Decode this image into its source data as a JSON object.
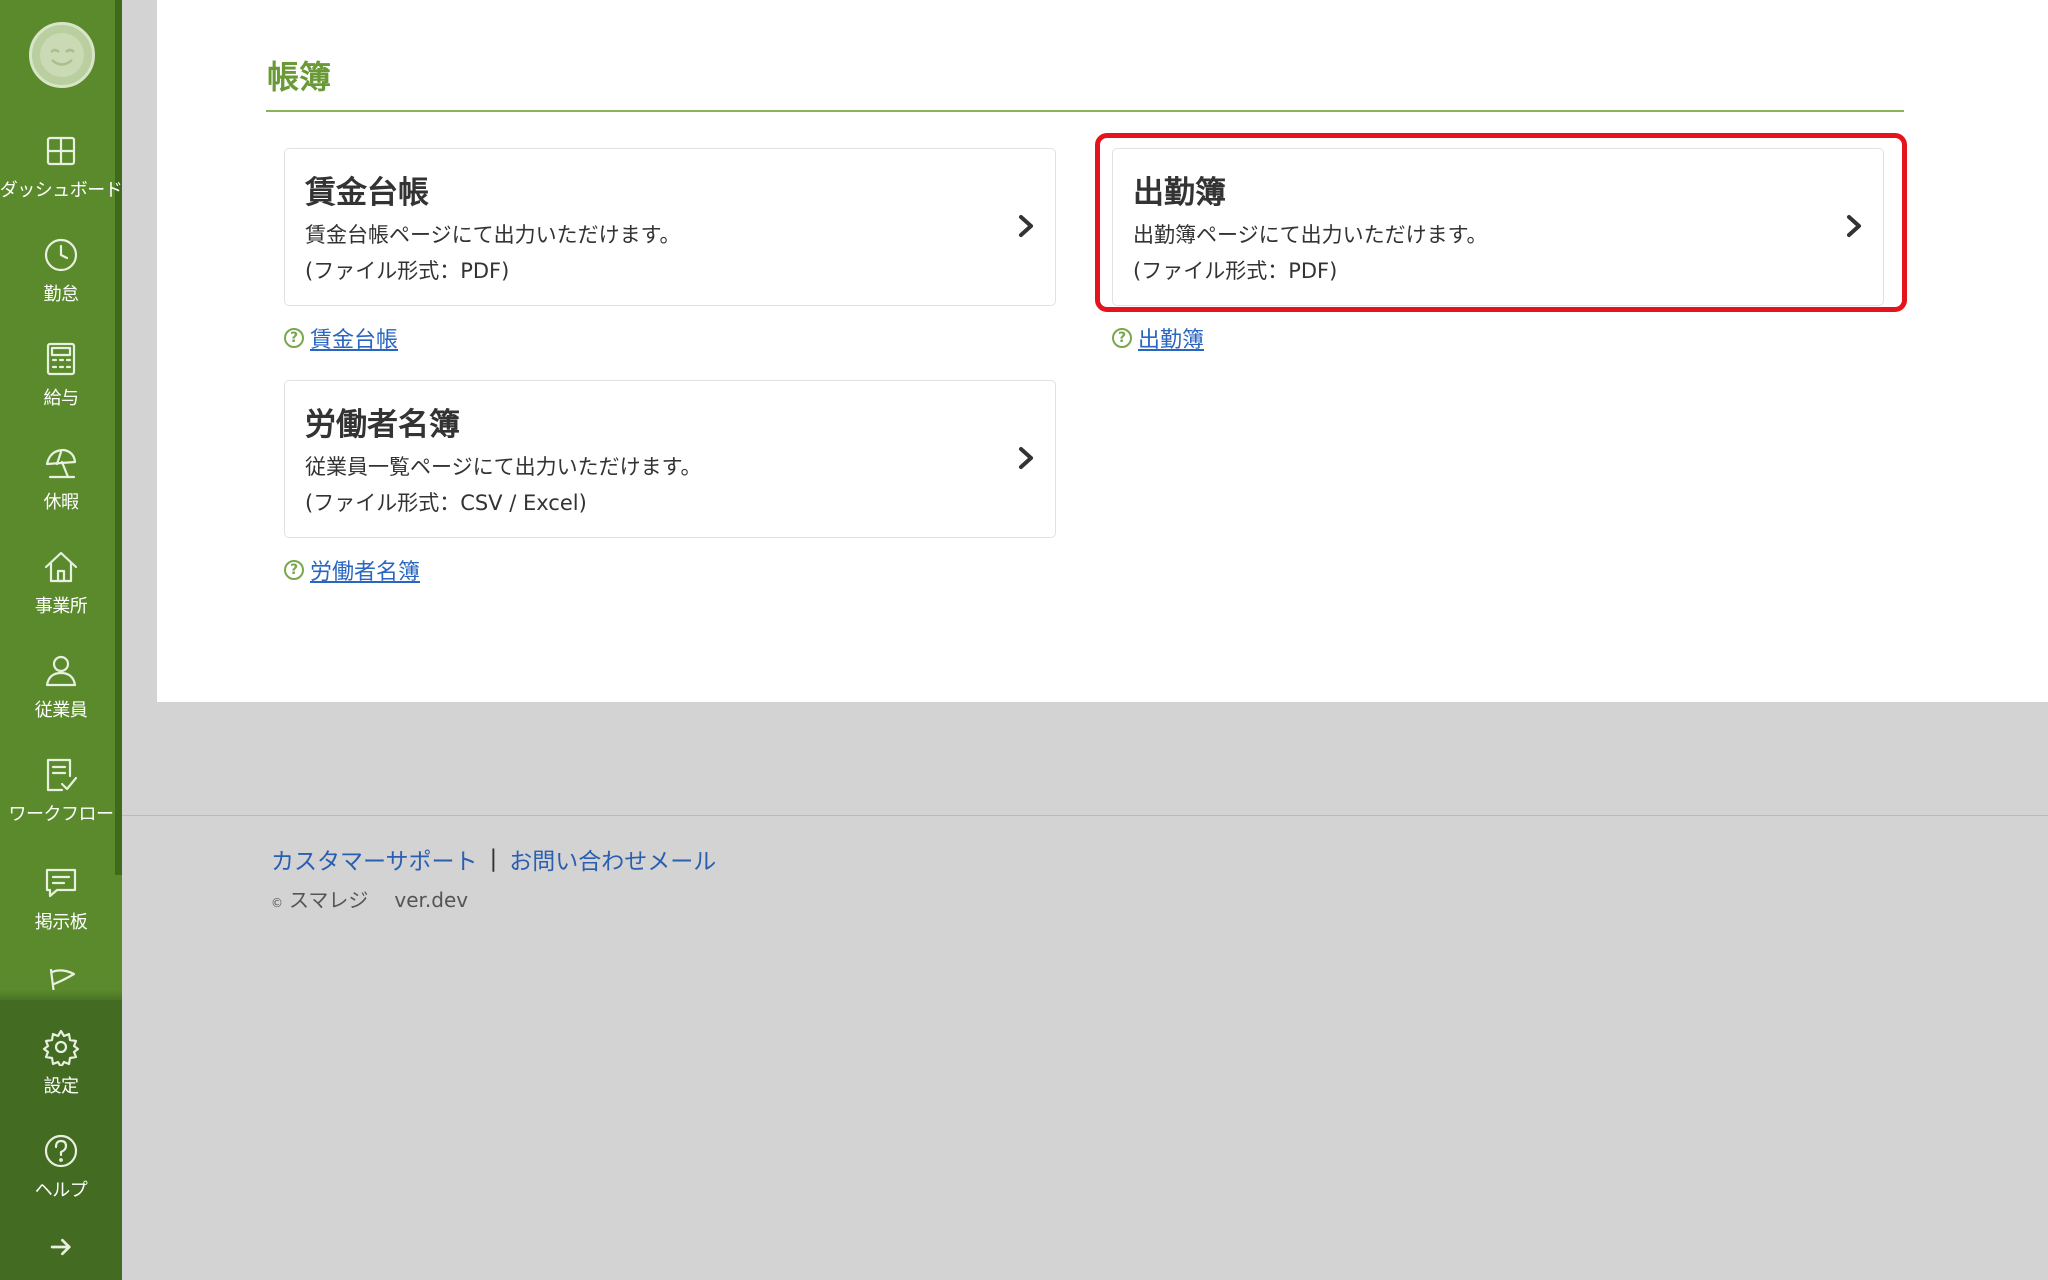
{
  "sidebar": {
    "items": [
      {
        "label": "ダッシュボード",
        "icon": "dashboard-icon"
      },
      {
        "label": "勤怠",
        "icon": "clock-icon"
      },
      {
        "label": "給与",
        "icon": "calculator-icon"
      },
      {
        "label": "休暇",
        "icon": "parasol-icon"
      },
      {
        "label": "事業所",
        "icon": "home-icon"
      },
      {
        "label": "従業員",
        "icon": "person-icon"
      },
      {
        "label": "ワークフロー",
        "icon": "checklist-icon"
      },
      {
        "label": "掲示板",
        "icon": "chat-icon"
      },
      {
        "label": "",
        "icon": "flag-icon"
      }
    ],
    "bottom_items": [
      {
        "label": "設定",
        "icon": "gear-icon"
      },
      {
        "label": "ヘルプ",
        "icon": "help-icon"
      },
      {
        "label": "",
        "icon": "arrow-right-icon"
      }
    ],
    "colors": {
      "background": "#5a8a2c",
      "bottom_background": "#446b22"
    }
  },
  "page": {
    "title": "帳簿"
  },
  "cards": [
    {
      "title": "賃金台帳",
      "description": "賃金台帳ページにて出力いただけます。",
      "format": "(ファイル形式：PDF)",
      "help_link": "賃金台帳"
    },
    {
      "title": "出勤簿",
      "description": "出勤簿ページにて出力いただけます。",
      "format": "(ファイル形式：PDF)",
      "help_link": "出勤簿",
      "highlighted": true
    },
    {
      "title": "労働者名簿",
      "description": "従業員一覧ページにて出力いただけます。",
      "format": "(ファイル形式：CSV / Excel)",
      "help_link": "労働者名簿"
    }
  ],
  "footer": {
    "support_link": "カスタマーサポート",
    "separator": "|",
    "contact_link": "お問い合わせメール",
    "copyright_mark": "©",
    "brand": "スマレジ",
    "version": "ver.dev"
  },
  "colors": {
    "accent_green": "#6a9a36",
    "link_blue": "#2a66c0",
    "highlight_red": "#e5141c",
    "background_gray": "#d3d3d3"
  }
}
